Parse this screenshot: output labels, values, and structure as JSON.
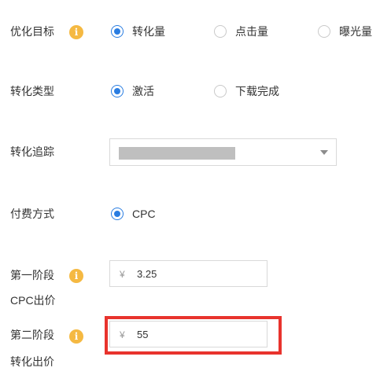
{
  "form": {
    "optimization_goal": {
      "label": "优化目标",
      "info_icon": "info-icon",
      "options": [
        {
          "label": "转化量",
          "checked": true
        },
        {
          "label": "点击量",
          "checked": false
        },
        {
          "label": "曝光量",
          "checked": false
        }
      ]
    },
    "conversion_type": {
      "label": "转化类型",
      "options": [
        {
          "label": "激活",
          "checked": true
        },
        {
          "label": "下载完成",
          "checked": false
        }
      ]
    },
    "conversion_tracking": {
      "label": "转化追踪",
      "dropdown_icon": "caret-down-icon"
    },
    "payment_method": {
      "label": "付费方式",
      "options": [
        {
          "label": "CPC",
          "checked": true
        }
      ]
    },
    "stage_one": {
      "label_line1": "第一阶段",
      "label_line2": "CPC出价",
      "currency": "¥",
      "value": "3.25",
      "info_icon": "info-icon"
    },
    "stage_two": {
      "label_line1": "第二阶段",
      "label_line2": "转化出价",
      "currency": "¥",
      "value": "55",
      "info_icon": "info-icon"
    }
  },
  "colors": {
    "accent": "#2a7de1",
    "info": "#f5b942",
    "highlight": "#e8332d"
  }
}
